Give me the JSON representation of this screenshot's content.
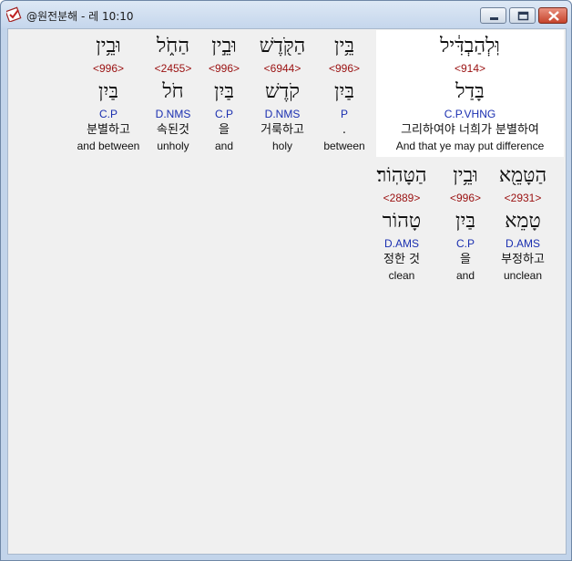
{
  "window": {
    "title": "@원전분해 - 레 10:10",
    "buttons": [
      "minimize",
      "maximize",
      "close"
    ]
  },
  "colors": {
    "strong_number": "#9a1010",
    "morphology": "#1a2fb0",
    "text": "#111111",
    "background": "#f0f0f0",
    "highlight": "#ffffff"
  },
  "words": [
    {
      "hebrew": "וּֽלְהַבְדִּ֔יל",
      "strong": "<914>",
      "lexeme": "בָּדַל",
      "morph": "C.P.VHNG",
      "korean": "그리하여야 너희가 분별하여",
      "english": "And that ye may put difference"
    },
    {
      "hebrew": "בֵּ֥ין",
      "strong": "<996>",
      "lexeme": "בַּיִן",
      "morph": "P",
      "korean": ".",
      "english": "between"
    },
    {
      "hebrew": "הַקֹּ֖דֶשׁ",
      "strong": "<6944>",
      "lexeme": "קֹדֶשׁ",
      "morph": "D.NMS",
      "korean": "거룩하고",
      "english": "holy"
    },
    {
      "hebrew": "וּבֵ֣ין",
      "strong": "<996>",
      "lexeme": "בַּיִן",
      "morph": "C.P",
      "korean": "을",
      "english": "and"
    },
    {
      "hebrew": "הַחֹ֑ל",
      "strong": "<2455>",
      "lexeme": "חֹל",
      "morph": "D.NMS",
      "korean": "속된것",
      "english": "unholy"
    },
    {
      "hebrew": "וּבֵ֥ין",
      "strong": "<996>",
      "lexeme": "בַּיִן",
      "morph": "C.P",
      "korean": "분별하고",
      "english": "and between"
    },
    {
      "hebrew": "הַטָּמֵ֖א",
      "strong": "<2931>",
      "lexeme": "טָמֵא",
      "morph": "D.AMS",
      "korean": "부정하고",
      "english": "unclean"
    },
    {
      "hebrew": "וּבֵ֥ין",
      "strong": "<996>",
      "lexeme": "בַּיִן",
      "morph": "C.P",
      "korean": "을",
      "english": "and"
    },
    {
      "hebrew": "הַטָּהֽוֹר׃",
      "strong": "<2889>",
      "lexeme": "טָהוֹר",
      "morph": "D.AMS",
      "korean": "정한 것",
      "english": "clean"
    }
  ]
}
